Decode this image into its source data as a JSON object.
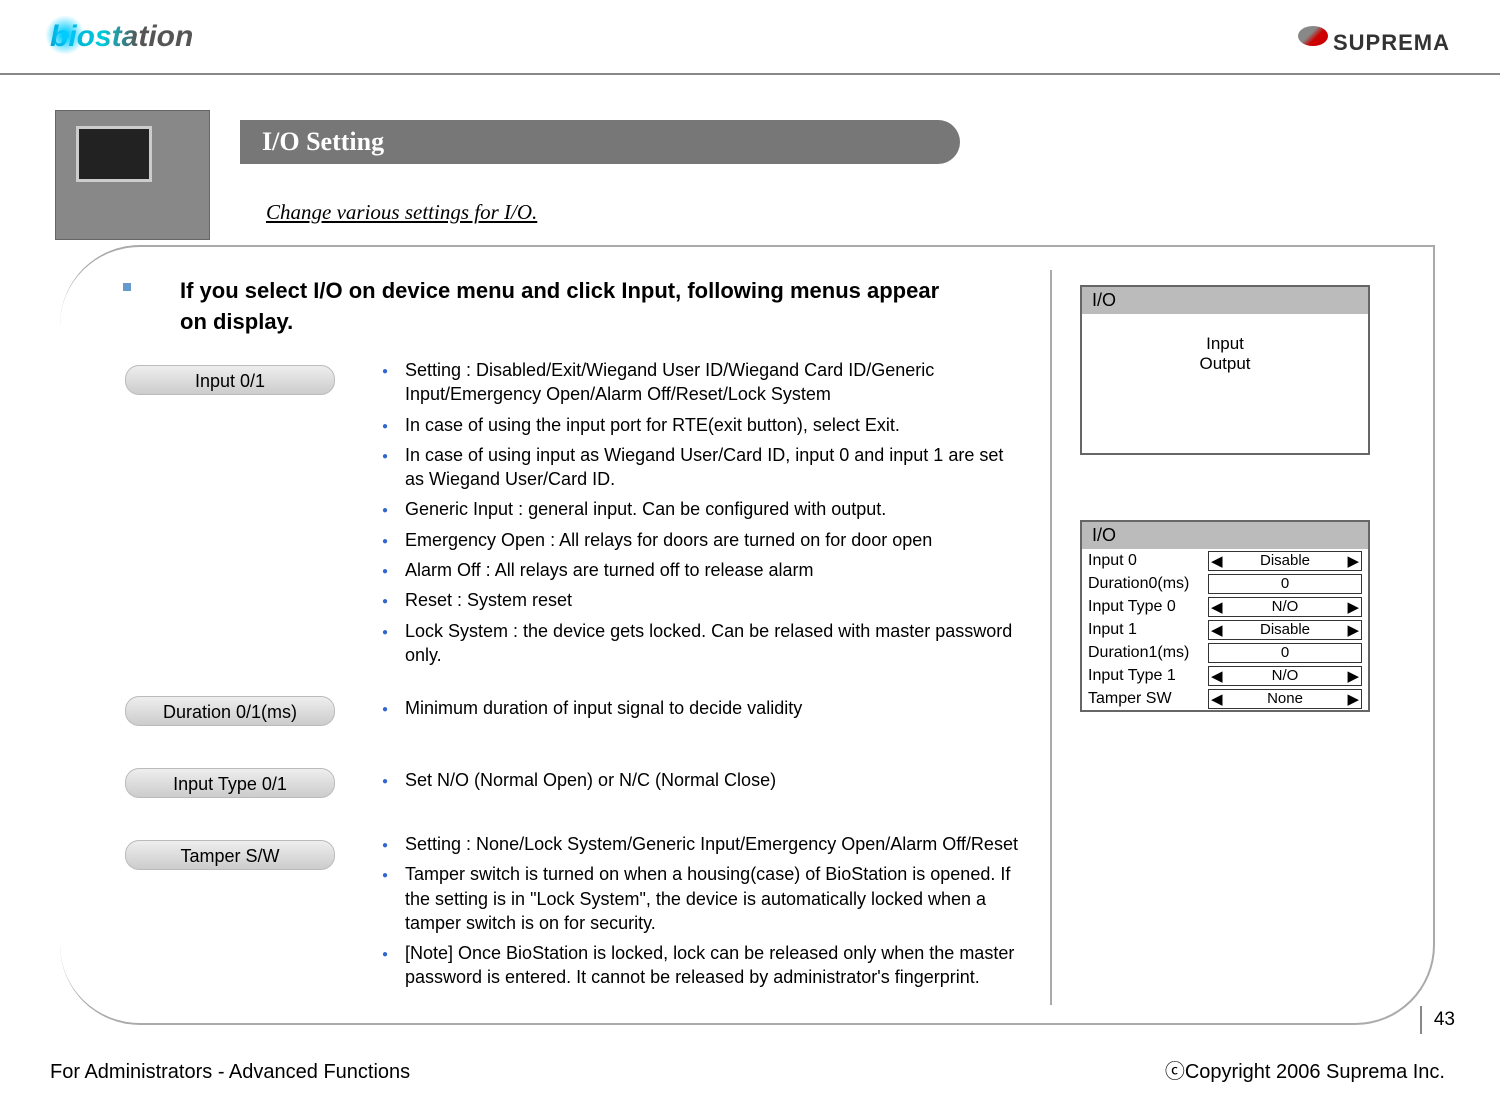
{
  "logos": {
    "left": "biostation",
    "right": "SUPREMA"
  },
  "title": "I/O Setting",
  "subtitle": "Change various settings for I/O.",
  "intro": "If you select I/O on device menu and click Input, following menus appear on display.",
  "pills": {
    "p1": "Input 0/1",
    "p2": "Duration 0/1(ms)",
    "p3": "Input Type 0/1",
    "p4": "Tamper S/W"
  },
  "group1": [
    "Setting : Disabled/Exit/Wiegand User ID/Wiegand Card ID/Generic Input/Emergency Open/Alarm Off/Reset/Lock System",
    "In case of using the input port for RTE(exit button), select Exit.",
    "In case of using input as Wiegand User/Card ID, input 0 and input 1 are set as Wiegand User/Card ID.",
    "Generic Input : general input. Can be configured with output.",
    "Emergency Open : All relays for doors are turned on for door open",
    "Alarm Off : All relays are turned off to release alarm",
    "Reset : System reset",
    "Lock System : the device gets locked. Can be relased with master password only."
  ],
  "group2": [
    "Minimum duration of input signal to decide validity"
  ],
  "group3": [
    "Set N/O (Normal Open) or N/C (Normal Close)"
  ],
  "group4": [
    "Setting : None/Lock System/Generic Input/Emergency Open/Alarm Off/Reset",
    "Tamper switch is turned on when a housing(case) of BioStation is opened. If the setting is in \"Lock System\", the device is automatically locked when a tamper switch is on for security.",
    "[Note] Once BioStation is locked, lock can be released only when the master password is entered. It cannot be released by administrator's fingerprint."
  ],
  "panel1": {
    "title": "I/O",
    "line1": "Input",
    "line2": "Output"
  },
  "panel2": {
    "title": "I/O",
    "rows": [
      {
        "label": "Input 0",
        "val": "Disable",
        "arrows": true
      },
      {
        "label": "Duration0(ms)",
        "val": "0",
        "arrows": false
      },
      {
        "label": "Input Type 0",
        "val": "N/O",
        "arrows": true
      },
      {
        "label": "Input 1",
        "val": "Disable",
        "arrows": true
      },
      {
        "label": "Duration1(ms)",
        "val": "0",
        "arrows": false
      },
      {
        "label": "Input Type 1",
        "val": "N/O",
        "arrows": true
      },
      {
        "label": "Tamper SW",
        "val": "None",
        "arrows": true
      }
    ]
  },
  "footer": {
    "left": "For Administrators - Advanced Functions",
    "right": "ⓒCopyright 2006 Suprema Inc."
  },
  "page": "43"
}
